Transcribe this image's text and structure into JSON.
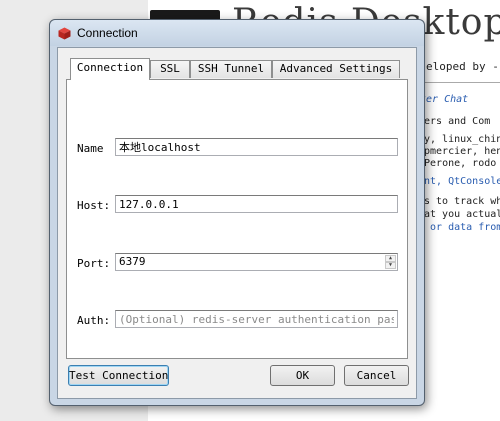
{
  "background": {
    "title": "Redis Desktop",
    "subtitle": "eloped by -",
    "lines": [
      "ter Chat",
      "kers and Com",
      "y, linux_chin",
      "pmercier, hen",
      "lPerone, rodo",
      "ent, QtConsole",
      "s to track whi",
      "at you actuall",
      "n or data from"
    ]
  },
  "dialog": {
    "title": "Connection",
    "tabs": [
      {
        "label": "Connection"
      },
      {
        "label": "SSL"
      },
      {
        "label": "SSH Tunnel"
      },
      {
        "label": "Advanced Settings"
      }
    ],
    "fields": {
      "name": {
        "label": "Name",
        "value": "本地localhost"
      },
      "host": {
        "label": "Host:",
        "value": "127.0.0.1"
      },
      "port": {
        "label": "Port:",
        "value": "6379"
      },
      "auth": {
        "label": "Auth:",
        "value": "",
        "placeholder": "(Optional) redis-server authentication pas…"
      }
    },
    "buttons": {
      "test": "Test Connection",
      "ok": "OK",
      "cancel": "Cancel"
    }
  },
  "colors": {
    "frame": "#c9d6e5",
    "panel": "#ffffff",
    "icon_red": "#d9302c"
  }
}
